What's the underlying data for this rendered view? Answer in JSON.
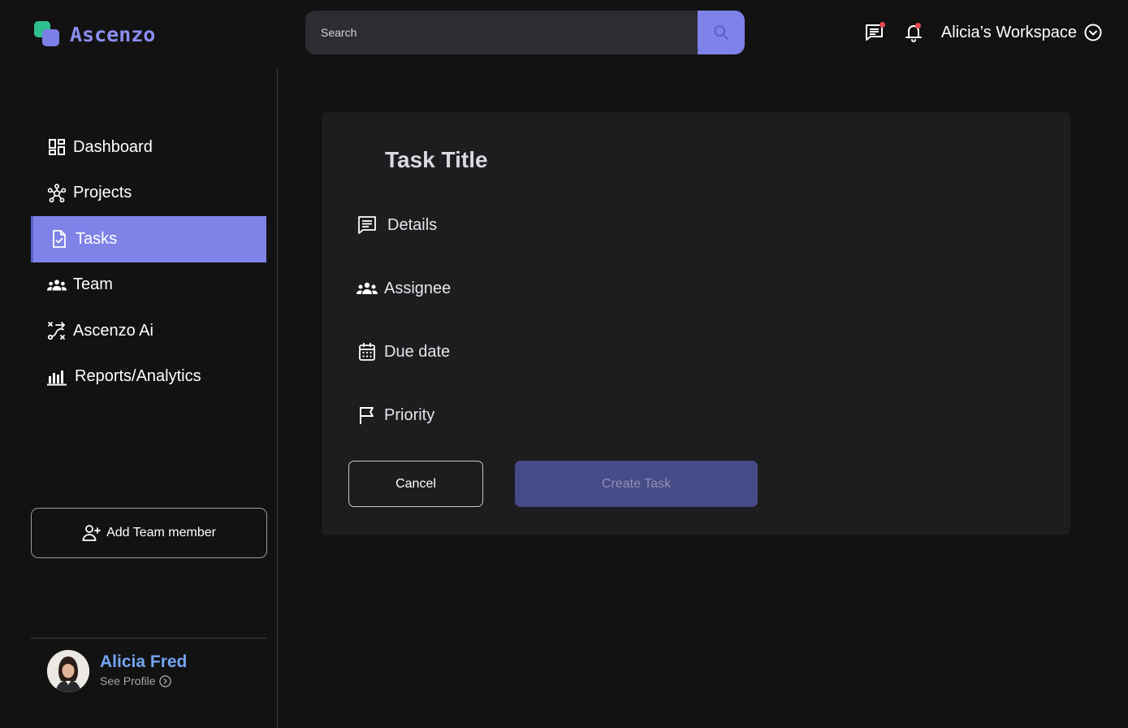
{
  "app": {
    "name": "Ascenzo"
  },
  "search": {
    "placeholder": "Search"
  },
  "topbar": {
    "workspace_label": "Alicia’s Workspace"
  },
  "sidebar": {
    "items": [
      {
        "label": "Dashboard",
        "icon": "dashboard-icon"
      },
      {
        "label": "Projects",
        "icon": "projects-icon"
      },
      {
        "label": "Tasks",
        "icon": "task-check-icon",
        "active": true
      },
      {
        "label": "Team",
        "icon": "team-icon"
      },
      {
        "label": "Ascenzo Ai",
        "icon": "ai-icon"
      },
      {
        "label": "Reports/Analytics",
        "icon": "bar-chart-icon"
      }
    ],
    "add_member_label": "Add Team member"
  },
  "profile": {
    "name": "Alicia Fred",
    "link_label": "See Profile"
  },
  "task_form": {
    "title": "Task Title",
    "fields": [
      {
        "label": "Details",
        "icon": "details-icon"
      },
      {
        "label": "Assignee",
        "icon": "assignee-icon"
      },
      {
        "label": "Due date",
        "icon": "calendar-icon"
      },
      {
        "label": "Priority",
        "icon": "flag-icon"
      }
    ],
    "cancel_label": "Cancel",
    "create_label": "Create Task"
  },
  "colors": {
    "accent": "#7f83e7",
    "brand_green": "#2fbf8f",
    "profile_name": "#74a6f0",
    "notification_dot": "#e5484d",
    "create_disabled_bg": "#464a86"
  }
}
